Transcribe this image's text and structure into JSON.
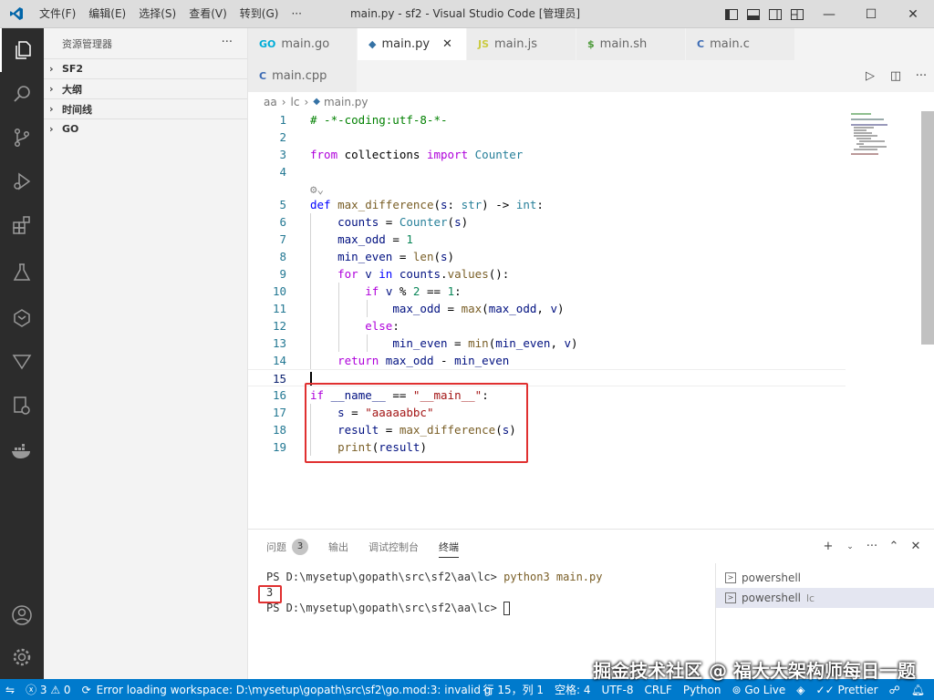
{
  "titlebar": {
    "menu": [
      "文件(F)",
      "编辑(E)",
      "选择(S)",
      "查看(V)",
      "转到(G)",
      "···"
    ],
    "title": "main.py - sf2 - Visual Studio Code [管理员]"
  },
  "sidebar": {
    "title": "资源管理器",
    "more": "···",
    "sections": [
      "SF2",
      "大纲",
      "时间线",
      "GO"
    ]
  },
  "tabs": [
    {
      "label": "main.go",
      "icon": "GO"
    },
    {
      "label": "main.py",
      "icon": "py"
    },
    {
      "label": "main.js",
      "icon": "JS"
    },
    {
      "label": "main.sh",
      "icon": "$"
    },
    {
      "label": "main.c",
      "icon": "C"
    },
    {
      "label": "main.cpp",
      "icon": "C"
    }
  ],
  "breadcrumb": [
    "aa",
    "lc",
    "main.py"
  ],
  "code": {
    "line_numbers": [
      "1",
      "2",
      "3",
      "4",
      "5",
      "6",
      "7",
      "8",
      "9",
      "10",
      "11",
      "12",
      "13",
      "14",
      "15",
      "16",
      "17",
      "18",
      "19"
    ]
  },
  "panel": {
    "tabs": [
      "问题",
      "输出",
      "调试控制台",
      "终端"
    ],
    "problems_count": "3",
    "terminal": {
      "prompt1": "PS D:\\mysetup\\gopath\\src\\sf2\\aa\\lc> ",
      "command": "python3 main.py",
      "output": "3",
      "prompt2": "PS D:\\mysetup\\gopath\\src\\sf2\\aa\\lc> "
    },
    "terminals": [
      "powershell",
      "powershell"
    ],
    "terminal_suffix": "lc"
  },
  "statusbar": {
    "errors": "3",
    "warnings": "0",
    "message": "Error loading workspace: D:\\mysetup\\gopath\\src\\sf2\\go.mod:3: invalid g",
    "position": "行 15，列 1",
    "spaces": "空格: 4",
    "encoding": "UTF-8",
    "eol": "CRLF",
    "language": "Python",
    "golive": "Go Live",
    "prettier": "Prettier"
  },
  "watermark": "掘金技术社区 @ 福大大架构师每日一题",
  "colors": {
    "accent": "#007acc",
    "highlight": "#e03030"
  }
}
